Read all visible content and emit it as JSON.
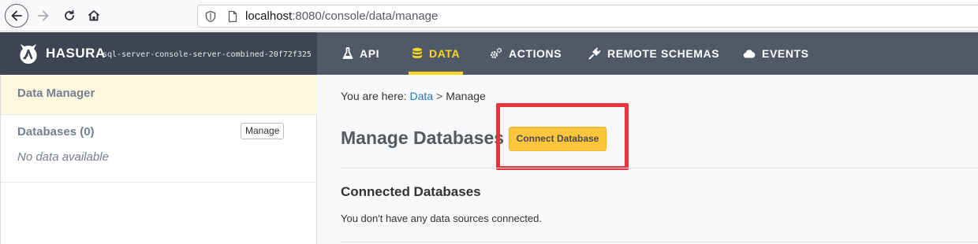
{
  "browser": {
    "url_host": "localhost",
    "url_path": ":8080/console/data/manage",
    "icons": [
      "back-arrow-icon",
      "forward-arrow-icon",
      "reload-icon",
      "home-icon",
      "shield-icon",
      "page-icon"
    ]
  },
  "topnav": {
    "logo_text": "HASURA",
    "project_name": "sql-server-console-server-combined-20f72f325",
    "items": [
      {
        "label": "API",
        "icon": "flask-icon",
        "active": false
      },
      {
        "label": "DATA",
        "icon": "database-icon",
        "active": true
      },
      {
        "label": "ACTIONS",
        "icon": "cogs-icon",
        "active": false
      },
      {
        "label": "REMOTE SCHEMAS",
        "icon": "plug-icon",
        "active": false
      },
      {
        "label": "EVENTS",
        "icon": "cloud-icon",
        "active": false
      }
    ],
    "colors": {
      "bar": "#505a67",
      "brand_bg": "#3d4452",
      "active": "#f8d721"
    }
  },
  "sidebar": {
    "title": "Data Manager",
    "databases_label": "Databases (0)",
    "manage_button": "Manage",
    "empty_text": "No data available"
  },
  "main": {
    "breadcrumb": {
      "prefix": "You are here:",
      "link": "Data",
      "separator": ">",
      "current": "Manage"
    },
    "title": "Manage Databases",
    "connect_button": "Connect Database",
    "section_title": "Connected Databases",
    "empty_message": "You don't have any data sources connected.",
    "colors": {
      "button": "#fec53d",
      "highlight": "#e8323c",
      "link": "#1f7ab8"
    }
  }
}
